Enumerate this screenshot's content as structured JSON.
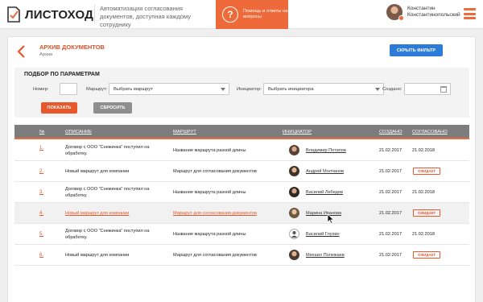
{
  "header": {
    "logo_text": "ЛИСТОХОД",
    "tagline": "Автоматизация согласования документов, доступная каждому сотруднику",
    "help_label": "Помощь и ответы на вопросы",
    "help_icon": "?",
    "user_name": "Константин Константинопольский",
    "accent_color": "#ee6a3a"
  },
  "page": {
    "title": "АРХИВ ДОКУМЕНТОВ",
    "breadcrumb": "Архив",
    "hide_filter_label": "СКРЫТЬ ФИЛЬТР"
  },
  "filter": {
    "title": "ПОДБОР ПО ПАРАМЕТРАМ",
    "number_label": "Номер:",
    "number_value": "",
    "route_label": "Маршрут:",
    "route_value": "Выбрать маршрут",
    "initiator_label": "Инициатор:",
    "initiator_value": "Выбрать инициатора",
    "created_label": "Создано:",
    "created_value": "",
    "show_label": "ПОКАЗАТЬ",
    "reset_label": "СБРОСИТЬ"
  },
  "table": {
    "columns": [
      "№",
      "ОПИСАНИЕ",
      "МАРШРУТ",
      "ИНИЦИАТОР",
      "СОЗДАНО",
      "СОГЛАСОВАНО"
    ],
    "rows": [
      {
        "num": "1.",
        "desc": "Договор с ООО \"Снежинка\" поступил на обработку.",
        "route": "Название маршрута разной длины",
        "initiator": "Владимир Потапов",
        "created": "21.02.2017",
        "approved": "21.02.2018",
        "status": ""
      },
      {
        "num": "2.",
        "desc": "Новый маршрут для компании",
        "route": "Маршрут для согласования документов",
        "initiator": "Андрей Молчанов",
        "created": "21.02.2017",
        "approved": "",
        "status": "ОЖИДАЕТ"
      },
      {
        "num": "3.",
        "desc": "Договор с ООО \"Снежинка\" поступил на обработку.",
        "route": "Название маршрута разной длины",
        "initiator": "Василий Лебедев",
        "created": "21.02.2017",
        "approved": "21.02.2018",
        "status": ""
      },
      {
        "num": "4.",
        "desc": "Новый маршрут для компании",
        "route": "Маршрут для согласования документов",
        "initiator": "Марина Иванова",
        "created": "21.02.2017",
        "approved": "",
        "status": "ОЖИДАЕТ"
      },
      {
        "num": "5.",
        "desc": "Договор с ООО \"Снежинка\" поступил на обработку.",
        "route": "Название маршрута разной длины",
        "initiator": "Василий Глухин",
        "created": "21.02.2017",
        "approved": "21.02.2018",
        "status": ""
      },
      {
        "num": "6.",
        "desc": "Новый маршрут для компании",
        "route": "Маршрут для согласования документов",
        "initiator": "Михаил Полежаев",
        "created": "21.02.2017",
        "approved": "",
        "status": "ОЖИДАЕТ"
      }
    ]
  }
}
